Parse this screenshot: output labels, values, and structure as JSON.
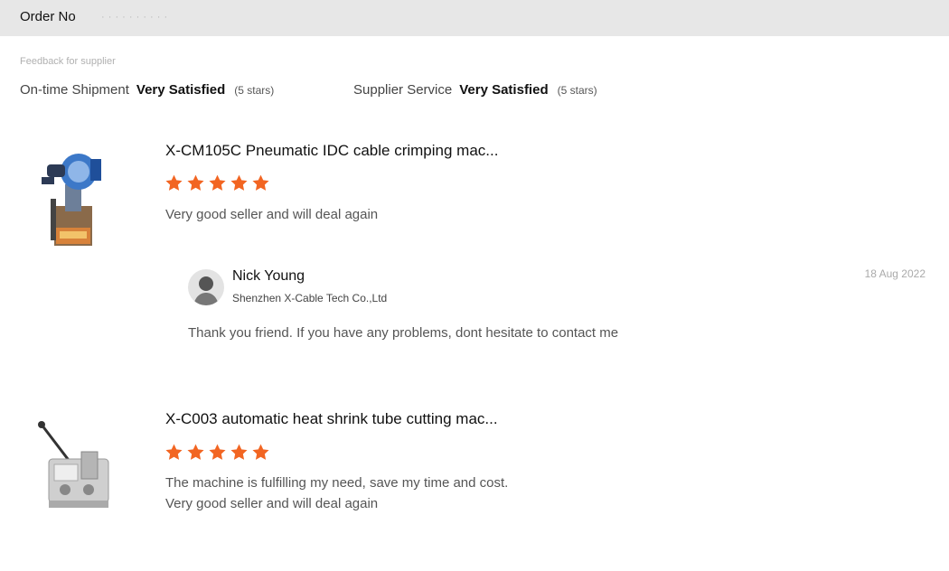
{
  "order": {
    "label": "Order No",
    "number": "· · · · · · · · · ·"
  },
  "feedback": {
    "heading": "Feedback for supplier",
    "shipment": {
      "label": "On-time Shipment",
      "value": "Very Satisfied",
      "stars": "(5 stars)"
    },
    "service": {
      "label": "Supplier Service",
      "value": "Very Satisfied",
      "stars": "(5 stars)"
    }
  },
  "products": [
    {
      "title": "X-CM105C Pneumatic IDC cable crimping mac...",
      "rating": 5,
      "reviews": [
        "Very good seller and will deal again"
      ],
      "image_icon": "crimping-machine"
    },
    {
      "title": "X-C003 automatic heat shrink tube cutting mac...",
      "rating": 5,
      "reviews": [
        "The machine is fulfilling my need, save my time and cost.",
        "Very good seller and will deal again"
      ],
      "image_icon": "tube-cutting-machine"
    }
  ],
  "reply": {
    "name": "Nick Young",
    "company": "Shenzhen X-Cable Tech Co.,Ltd",
    "date": "18 Aug 2022",
    "text": "Thank you friend. If you have any problems, dont hesitate to contact me"
  },
  "colors": {
    "star": "#f26522",
    "order_bar": "#e7e7e7"
  }
}
